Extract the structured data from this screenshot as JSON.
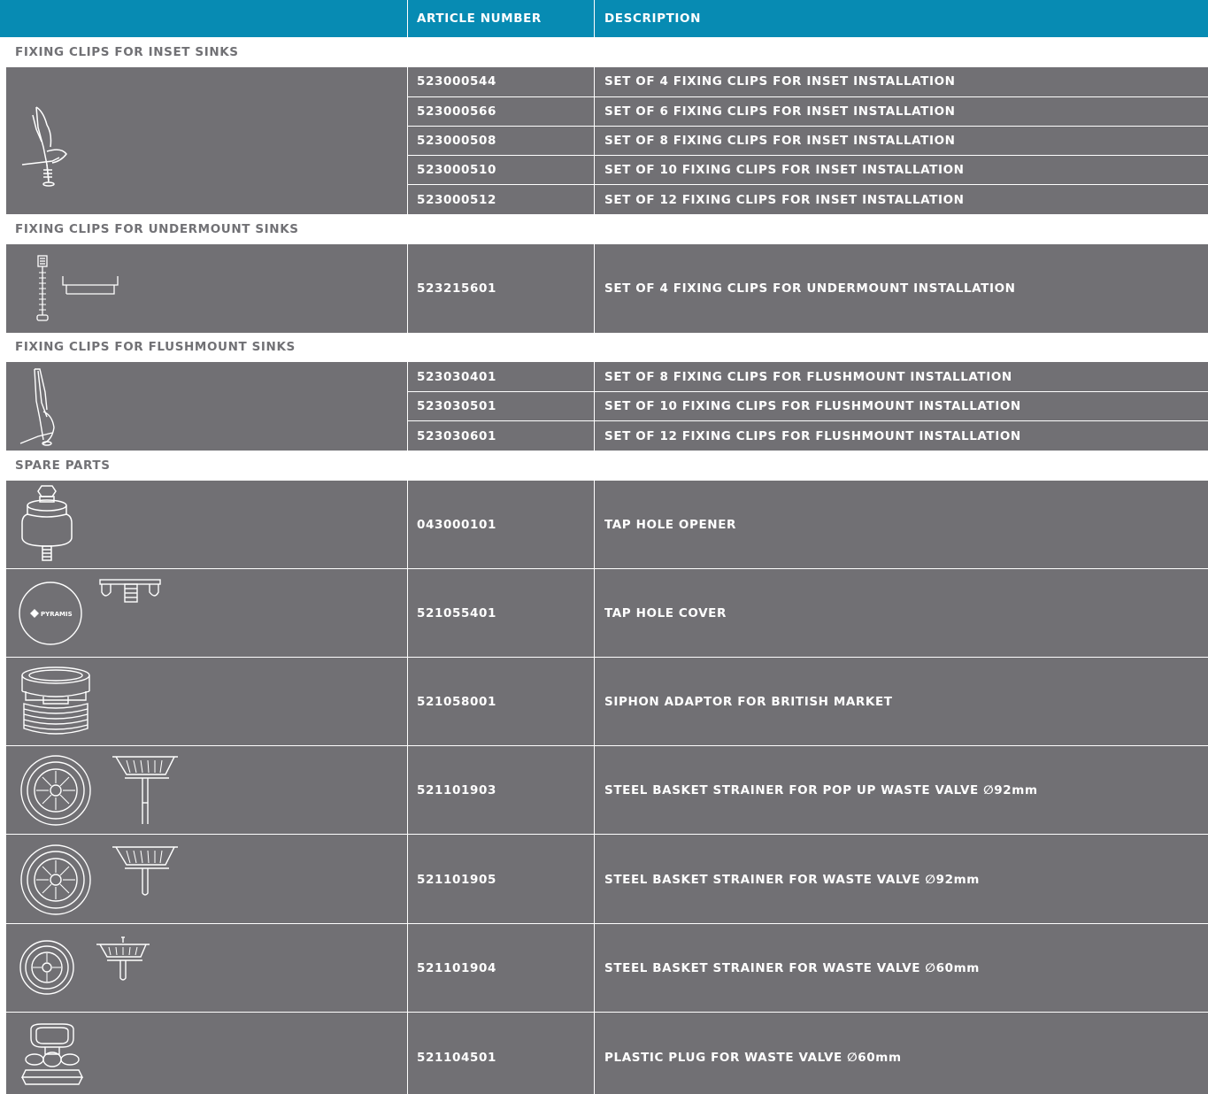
{
  "header": {
    "article_number": "ARTICLE NUMBER",
    "description": "DESCRIPTION"
  },
  "sections": [
    {
      "title": "FIXING CLIPS FOR INSET SINKS",
      "rows": [
        {
          "article": "523000544",
          "description": "SET OF 4 FIXING CLIPS FOR INSET INSTALLATION"
        },
        {
          "article": "523000566",
          "description": "SET OF 6 FIXING CLIPS FOR INSET INSTALLATION"
        },
        {
          "article": "523000508",
          "description": "SET OF 8 FIXING CLIPS FOR INSET INSTALLATION"
        },
        {
          "article": "523000510",
          "description": "SET OF 10 FIXING CLIPS FOR INSET INSTALLATION"
        },
        {
          "article": "523000512",
          "description": "SET OF 12 FIXING CLIPS FOR INSET INSTALLATION"
        }
      ]
    },
    {
      "title": "FIXING CLIPS FOR UNDERMOUNT SINKS",
      "rows": [
        {
          "article": "523215601",
          "description": "SET OF 4 FIXING CLIPS FOR UNDERMOUNT INSTALLATION"
        }
      ]
    },
    {
      "title": "FIXING CLIPS FOR FLUSHMOUNT SINKS",
      "rows": [
        {
          "article": "523030401",
          "description": "SET OF 8 FIXING CLIPS FOR FLUSHMOUNT INSTALLATION"
        },
        {
          "article": "523030501",
          "description": "SET OF 10 FIXING CLIPS FOR FLUSHMOUNT INSTALLATION"
        },
        {
          "article": "523030601",
          "description": "SET OF 12 FIXING CLIPS FOR FLUSHMOUNT INSTALLATION"
        }
      ]
    },
    {
      "title": "SPARE PARTS",
      "rows": [
        {
          "article": "043000101",
          "description": "TAP HOLE OPENER"
        },
        {
          "article": "521055401",
          "description": "TAP HOLE COVER",
          "logo_text": "PYRAMIS"
        },
        {
          "article": "521058001",
          "description": "SIPHON ADAPTOR FOR BRITISH MARKET"
        },
        {
          "article": "521101903",
          "description": "STEEL BASKET STRAINER FOR POP UP WASTE VALVE ∅92mm"
        },
        {
          "article": "521101905",
          "description": "STEEL BASKET STRAINER FOR WASTE VALVE ∅92mm"
        },
        {
          "article": "521101904",
          "description": "STEEL BASKET STRAINER FOR WASTE VALVE ∅60mm"
        },
        {
          "article": "521104501",
          "description": "PLASTIC PLUG FOR WASTE VALVE ∅60mm"
        }
      ]
    }
  ],
  "colors": {
    "header": "#078bb3",
    "row": "#717074",
    "section_text": "#717175"
  }
}
